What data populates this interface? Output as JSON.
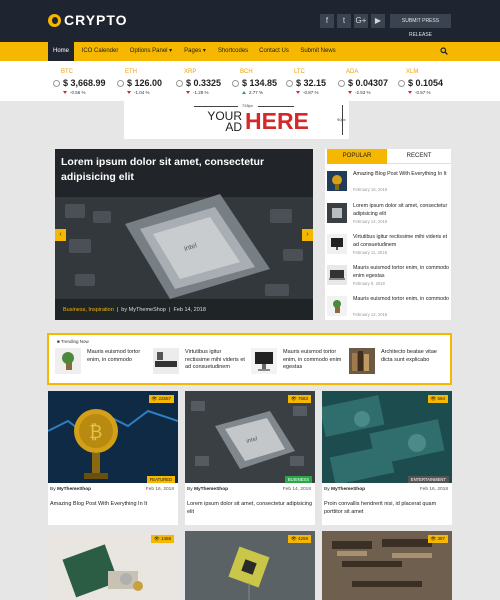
{
  "brand": {
    "name": "CRYPTO",
    "accent": "#f5b700",
    "dark": "#1e2530"
  },
  "header": {
    "social": [
      {
        "icon": "facebook-icon",
        "glyph": "f"
      },
      {
        "icon": "twitter-icon",
        "glyph": "t"
      },
      {
        "icon": "googleplus-icon",
        "glyph": "G+"
      },
      {
        "icon": "youtube-icon",
        "glyph": "▶"
      }
    ],
    "press_button": "SUBMIT PRESS RELEASE"
  },
  "nav": {
    "items": [
      "Home",
      "ICO Calender",
      "Options Panel",
      "Pages",
      "Shortcodes",
      "Contact Us",
      "Submit News"
    ],
    "active": "Home"
  },
  "ticker": [
    {
      "symbol": "BTC",
      "price": "$ 3,668.99",
      "change": "-0.56 %",
      "direction": "down"
    },
    {
      "symbol": "ETH",
      "price": "$ 126.00",
      "change": "-1.04 %",
      "direction": "down"
    },
    {
      "symbol": "XRP",
      "price": "$ 0.3325",
      "change": "-1.28 %",
      "direction": "down"
    },
    {
      "symbol": "BCH",
      "price": "$ 134.85",
      "change": "2.77 %",
      "direction": "up"
    },
    {
      "symbol": "LTC",
      "price": "$ 32.15",
      "change": "-0.87 %",
      "direction": "down"
    },
    {
      "symbol": "ADA",
      "price": "$ 0.04307",
      "change": "-2.53 %",
      "direction": "down"
    },
    {
      "symbol": "XLM",
      "price": "$ 0.1054",
      "change": "-0.57 %",
      "direction": "down"
    }
  ],
  "ad": {
    "width_label": "728px",
    "line1": "YOUR",
    "line2": "AD",
    "highlight": "HERE",
    "height_label": "90px"
  },
  "slider": {
    "title": "Lorem ipsum dolor sit amet, consectetur adipisicing elit",
    "categories": "Business, Inspiration",
    "author": "by MyThemeShop",
    "date": "Feb 14, 2018",
    "prev": "‹",
    "next": "›"
  },
  "widget": {
    "tabs": [
      "POPULAR",
      "RECENT"
    ],
    "items": [
      {
        "title": "Amazing Blog Post With Everything In It",
        "date": "February 16, 2018",
        "thumb": "bitcoin"
      },
      {
        "title": "Lorem ipsum dolor sit amet, consectetur adipisicing elit",
        "date": "February 14, 2018",
        "thumb": "cpu"
      },
      {
        "title": "Virtutibus igitur rectissime mihi videris et ad consuetudinem",
        "date": "February 11, 2018",
        "thumb": "monitor"
      },
      {
        "title": "Mauris euismod tortor enim, in commodo enim egestas",
        "date": "February 9, 2018",
        "thumb": "laptop"
      },
      {
        "title": "Mauris euismod tortor enim, in commodo",
        "date": "February 12, 2018",
        "thumb": "plant"
      }
    ]
  },
  "trending": {
    "label": "Trending Now",
    "items": [
      {
        "title": "Mauris euismod tortor enim, in commodo",
        "thumb": "plant"
      },
      {
        "title": "Virtutibus igitur rectissime mihi videris et ad consuetudinem",
        "thumb": "keyboard"
      },
      {
        "title": "Mauris euismod tortor enim, in commodo enim egestas",
        "thumb": "monitor"
      },
      {
        "title": "Architecto beatae vitae dicta sunt explicabo",
        "thumb": "books"
      }
    ]
  },
  "posts": [
    {
      "views": "22557",
      "category": "FEATURED",
      "category_color": "#f5b700",
      "author": "MyThemeShop",
      "date": "Feb 16, 2018",
      "title": "Amazing Blog Post With Everything In It",
      "thumb": "bitcoin"
    },
    {
      "views": "7583",
      "category": "BUSINESS",
      "category_color": "#28a745",
      "author": "MyThemeShop",
      "date": "Feb 14, 2018",
      "title": "Lorem ipsum dolor sit amet, consectetur adipisicing elit",
      "thumb": "cpu"
    },
    {
      "views": "564",
      "category": "ENTERTAINMENT",
      "category_color": "#555555",
      "author": "MyThemeShop",
      "date": "Feb 16, 2018",
      "title": "Proin convallis hendrerit nisi, id placerat quam porttitor sit amet",
      "thumb": "money"
    },
    {
      "views": "1458",
      "thumb": "wallet"
    },
    {
      "views": "4259",
      "thumb": "chip"
    },
    {
      "views": "387",
      "thumb": "board"
    }
  ],
  "labels": {
    "by": "By"
  }
}
